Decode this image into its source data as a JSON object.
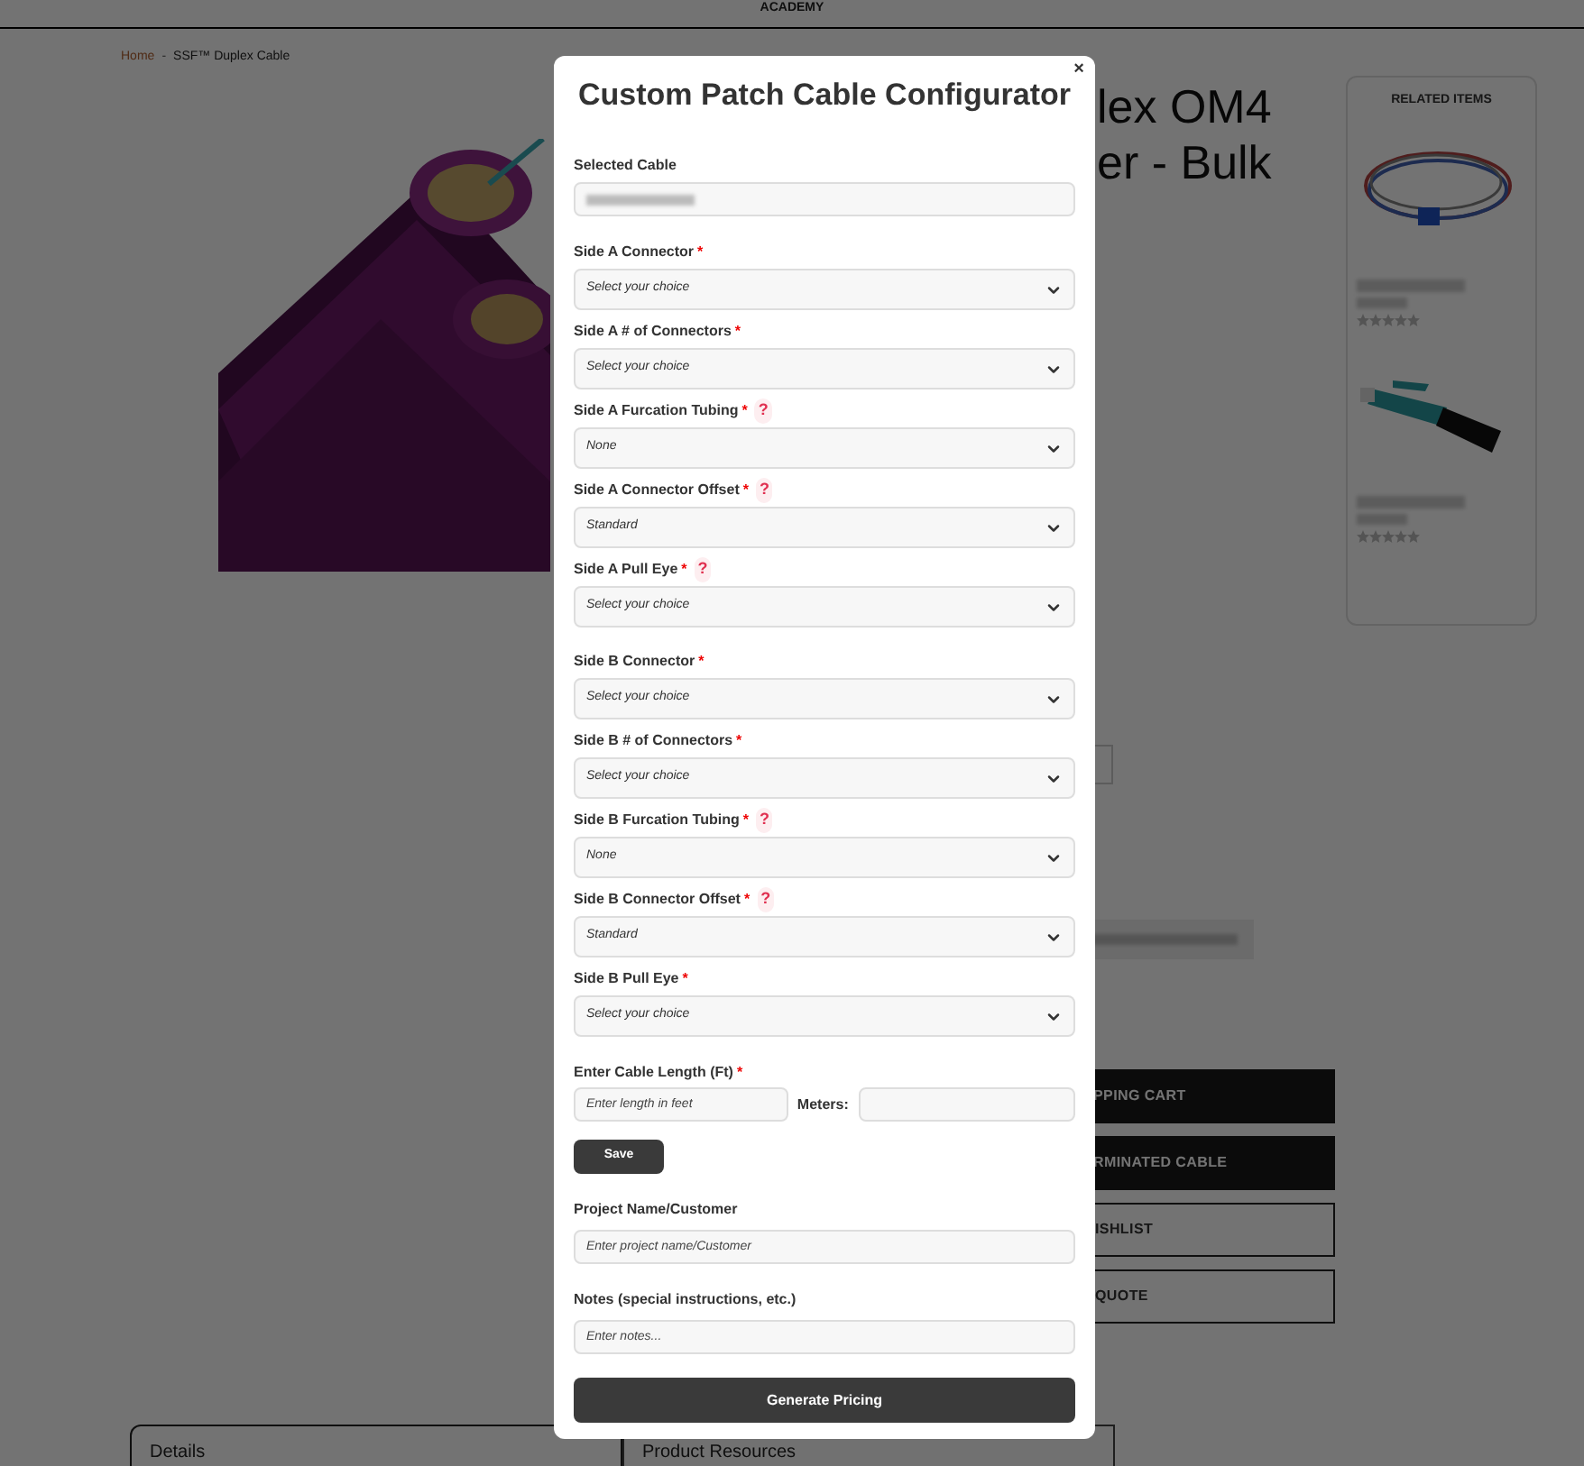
{
  "header": {
    "brand": "ACADEMY"
  },
  "breadcrumb": {
    "separator": "-",
    "items": [
      {
        "label": "Home",
        "selected": false
      },
      {
        "label": "SSF™ Duplex Cable",
        "selected": true
      }
    ]
  },
  "product": {
    "kind": "picture",
    "title_lines": [
      "lex OM4",
      "er - Bulk"
    ]
  },
  "cart_buttons": [
    {
      "label": "PPING CART",
      "kind": "solid"
    },
    {
      "label": "RMINATED CABLE",
      "kind": "solid"
    },
    {
      "label": "ISHLIST",
      "kind": "outline"
    },
    {
      "label": "QUOTE",
      "kind": "outline"
    }
  ],
  "related": {
    "title": "RELATED ITEMS",
    "items": [
      {
        "kind": "picture",
        "stars": 0
      },
      {
        "kind": "picture",
        "stars": 0
      }
    ]
  },
  "tabs": [
    {
      "label": "Details",
      "selected": true
    },
    {
      "label": "Product Resources",
      "selected": false
    }
  ],
  "modal": {
    "title": "Custom Patch Cable Configurator",
    "close": "×",
    "selected_cable": {
      "label": "Selected Cable"
    },
    "sides": [
      {
        "fields": [
          {
            "label": "Side A Connector",
            "required_mark": "*",
            "value": "Select your choice"
          },
          {
            "label": "Side A # of Connectors",
            "required_mark": "*",
            "value": "Select your choice"
          },
          {
            "label": "Side A Furcation Tubing",
            "required_mark": "*",
            "help": "?",
            "value": "None"
          },
          {
            "label": "Side A Connector Offset",
            "required_mark": "*",
            "help": "?",
            "value": "Standard"
          },
          {
            "label": "Side A Pull Eye",
            "required_mark": "*",
            "help": "?",
            "value": "Select your choice"
          }
        ]
      },
      {
        "fields": [
          {
            "label": "Side B Connector",
            "required_mark": "*",
            "value": "Select your choice"
          },
          {
            "label": "Side B # of Connectors",
            "required_mark": "*",
            "value": "Select your choice"
          },
          {
            "label": "Side B Furcation Tubing",
            "required_mark": "*",
            "help": "?",
            "value": "None"
          },
          {
            "label": "Side B Connector Offset",
            "required_mark": "*",
            "help": "?",
            "value": "Standard"
          },
          {
            "label": "Side B Pull Eye",
            "required_mark": "*",
            "value": "Select your choice"
          }
        ]
      }
    ],
    "length": {
      "label": "Enter Cable Length (Ft)",
      "required_mark": "*",
      "placeholder": "Enter length in feet",
      "meters_label": "Meters:"
    },
    "save": "Save",
    "project": {
      "label": "Project Name/Customer",
      "placeholder": "Enter project name/Customer"
    },
    "notes": {
      "label": "Notes (special instructions, etc.)",
      "placeholder": "Enter notes..."
    },
    "submit": "Generate Pricing"
  }
}
